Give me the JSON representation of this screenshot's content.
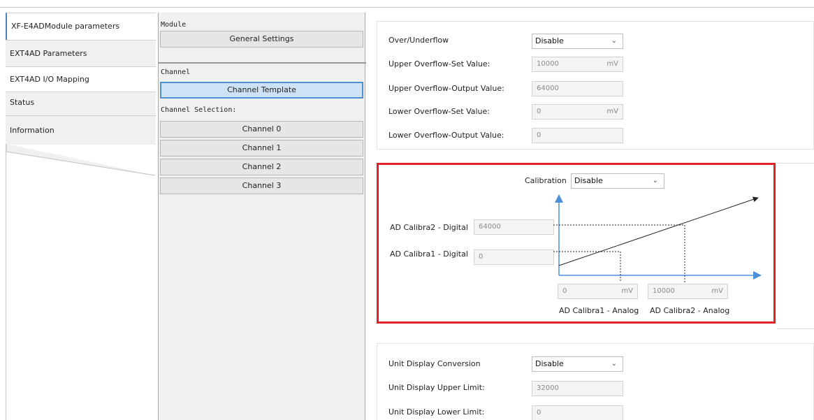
{
  "left_tabs": [
    {
      "label": "XF-E4ADModule parameters"
    },
    {
      "label": "EXT4AD Parameters"
    },
    {
      "label": "EXT4AD I/O Mapping"
    },
    {
      "label": "Status"
    },
    {
      "label": "Information"
    }
  ],
  "middle": {
    "module_label": "Module",
    "general_settings": "General Settings",
    "channel_label": "Channel",
    "channel_template": "Channel Template",
    "channel_selection_label": "Channel Selection:",
    "channels": [
      "Channel 0",
      "Channel 1",
      "Channel 2",
      "Channel 3"
    ]
  },
  "overflow": {
    "over_underflow_label": "Over/Underflow",
    "over_underflow_value": "Disable",
    "upper_set_label": "Upper Overflow-Set Value:",
    "upper_set_value": "10000",
    "upper_set_unit": "mV",
    "upper_output_label": "Upper Overflow-Output Value:",
    "upper_output_value": "64000",
    "lower_set_label": "Lower Overflow-Set Value:",
    "lower_set_value": "0",
    "lower_set_unit": "mV",
    "lower_output_label": "Lower Overflow-Output Value:",
    "lower_output_value": "0"
  },
  "calibration": {
    "label": "Calibration",
    "value": "Disable",
    "calibra2_digital_label": "AD Calibra2 - Digital",
    "calibra2_digital_value": "64000",
    "calibra1_digital_label": "AD Calibra1 - Digital",
    "calibra1_digital_value": "0",
    "calibra1_analog_value": "0",
    "calibra1_analog_unit": "mV",
    "calibra1_analog_label": "AD Calibra1 - Analog",
    "calibra2_analog_value": "10000",
    "calibra2_analog_unit": "mV",
    "calibra2_analog_label": "AD Calibra2 - Analog",
    "accent_color": "#e0212a",
    "axis_color": "#4a90d9"
  },
  "unit_display": {
    "conversion_label": "Unit Display Conversion",
    "conversion_value": "Disable",
    "upper_label": "Unit Display Upper Limit:",
    "upper_value": "32000",
    "lower_label": "Unit Display Lower Limit:",
    "lower_value": "0"
  }
}
